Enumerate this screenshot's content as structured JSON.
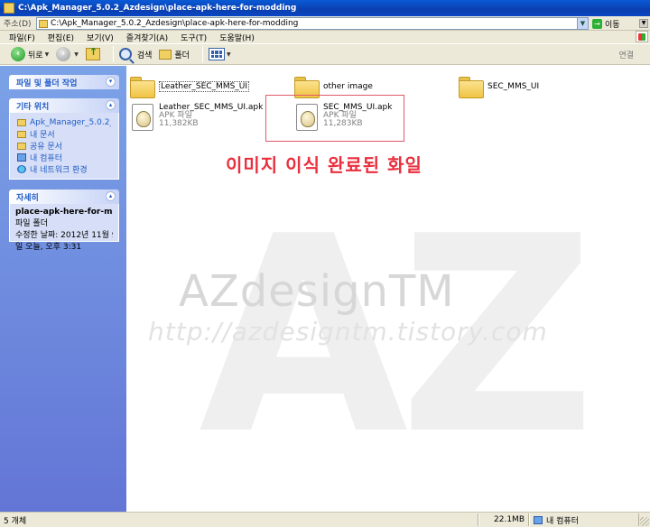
{
  "window": {
    "title": "C:\\Apk_Manager_5.0.2_Azdesign\\place-apk-here-for-modding"
  },
  "address": {
    "label": "주소(D)",
    "path": "C:\\Apk_Manager_5.0.2_Azdesign\\place-apk-here-for-modding",
    "go_label": "이동"
  },
  "menu": {
    "items": [
      "파일(F)",
      "편집(E)",
      "보기(V)",
      "즐겨찾기(A)",
      "도구(T)",
      "도움말(H)"
    ]
  },
  "toolbar": {
    "back_label": "뒤로",
    "search_label": "검색",
    "folders_label": "폴더",
    "links_label": "연결"
  },
  "sidebar": {
    "tasks": {
      "title": "파일 및 폴더 작업"
    },
    "places": {
      "title": "기타 위치",
      "items": [
        {
          "label": "Apk_Manager_5.0.2_Az",
          "icon": "folder-icon"
        },
        {
          "label": "내 문서",
          "icon": "folder-icon"
        },
        {
          "label": "공유 문서",
          "icon": "folder-icon"
        },
        {
          "label": "내 컴퓨터",
          "icon": "computer-icon"
        },
        {
          "label": "내 네트워크 환경",
          "icon": "network-icon"
        }
      ]
    },
    "details": {
      "title": "자세히",
      "name": "place-apk-here-for-mod",
      "type": "파일 폴더",
      "modified_label": "수정한 날짜: 2012년 11월 9",
      "modified_time": "일 오늘, 오후 3:31"
    }
  },
  "content": {
    "folders": [
      {
        "name": "Leather_SEC_MMS_UI"
      },
      {
        "name": "other image"
      },
      {
        "name": "SEC_MMS_UI"
      }
    ],
    "files": [
      {
        "name": "Leather_SEC_MMS_UI.apk",
        "type": "APK 파일",
        "size": "11,382KB"
      },
      {
        "name": "SEC_MMS_UI.apk",
        "type": "APK 파일",
        "size": "11,283KB"
      }
    ],
    "annotation": "이미지 이식 완료된 화일",
    "watermark": {
      "logo": "AZ",
      "brand": "AZdesignTM",
      "url": "http://azdesigntm.tistory.com"
    }
  },
  "status": {
    "count": "5 개체",
    "size": "22.1MB",
    "location": "내 컴퓨터"
  }
}
